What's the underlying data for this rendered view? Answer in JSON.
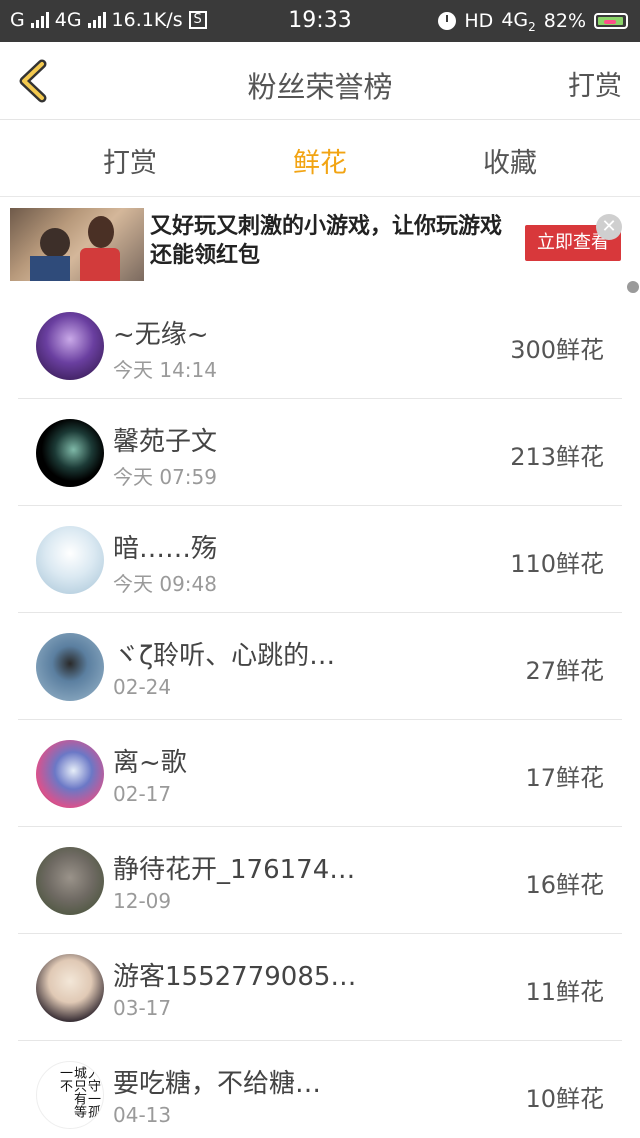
{
  "status_bar": {
    "left_net1": "G",
    "left_net2": "4G",
    "speed": "16.1K/s",
    "s_badge": "S",
    "time": "19:33",
    "hd_label": "HD",
    "net_right": "4G",
    "net_sub": "2",
    "battery": "82%",
    "icons": [
      "signal-icon",
      "alarm-icon",
      "battery-icon"
    ]
  },
  "navbar": {
    "back_icon": "chevron-left-icon",
    "title": "粉丝荣誉榜",
    "right_action": "打赏"
  },
  "tabs": [
    {
      "label": "打赏",
      "active": false
    },
    {
      "label": "鲜花",
      "active": true
    },
    {
      "label": "收藏",
      "active": false
    }
  ],
  "ad": {
    "text": "又好玩又刺激的小游戏，让你玩游戏还能领红包",
    "button": "立即查看",
    "close_icon": "close-icon"
  },
  "fans": [
    {
      "name": "~无缘~",
      "time": "今天 14:14",
      "count": "300鲜花"
    },
    {
      "name": "馨苑子文",
      "time": "今天 07:59",
      "count": "213鲜花"
    },
    {
      "name": "暗……殇",
      "time": "今天 09:48",
      "count": "110鲜花"
    },
    {
      "name": "ヾζ聆听、心跳的…",
      "time": "02-24",
      "count": "27鲜花"
    },
    {
      "name": "离~歌",
      "time": "02-17",
      "count": "17鲜花"
    },
    {
      "name": "静待花开_176174…",
      "time": "12-09",
      "count": "16鲜花"
    },
    {
      "name": "游客1552779085…",
      "time": "03-17",
      "count": "11鲜花"
    },
    {
      "name": "要吃糖，不给糖…",
      "time": "04-13",
      "count": "10鲜花"
    }
  ],
  "avatar_calligraphy": "入守一孤城只有等一不"
}
